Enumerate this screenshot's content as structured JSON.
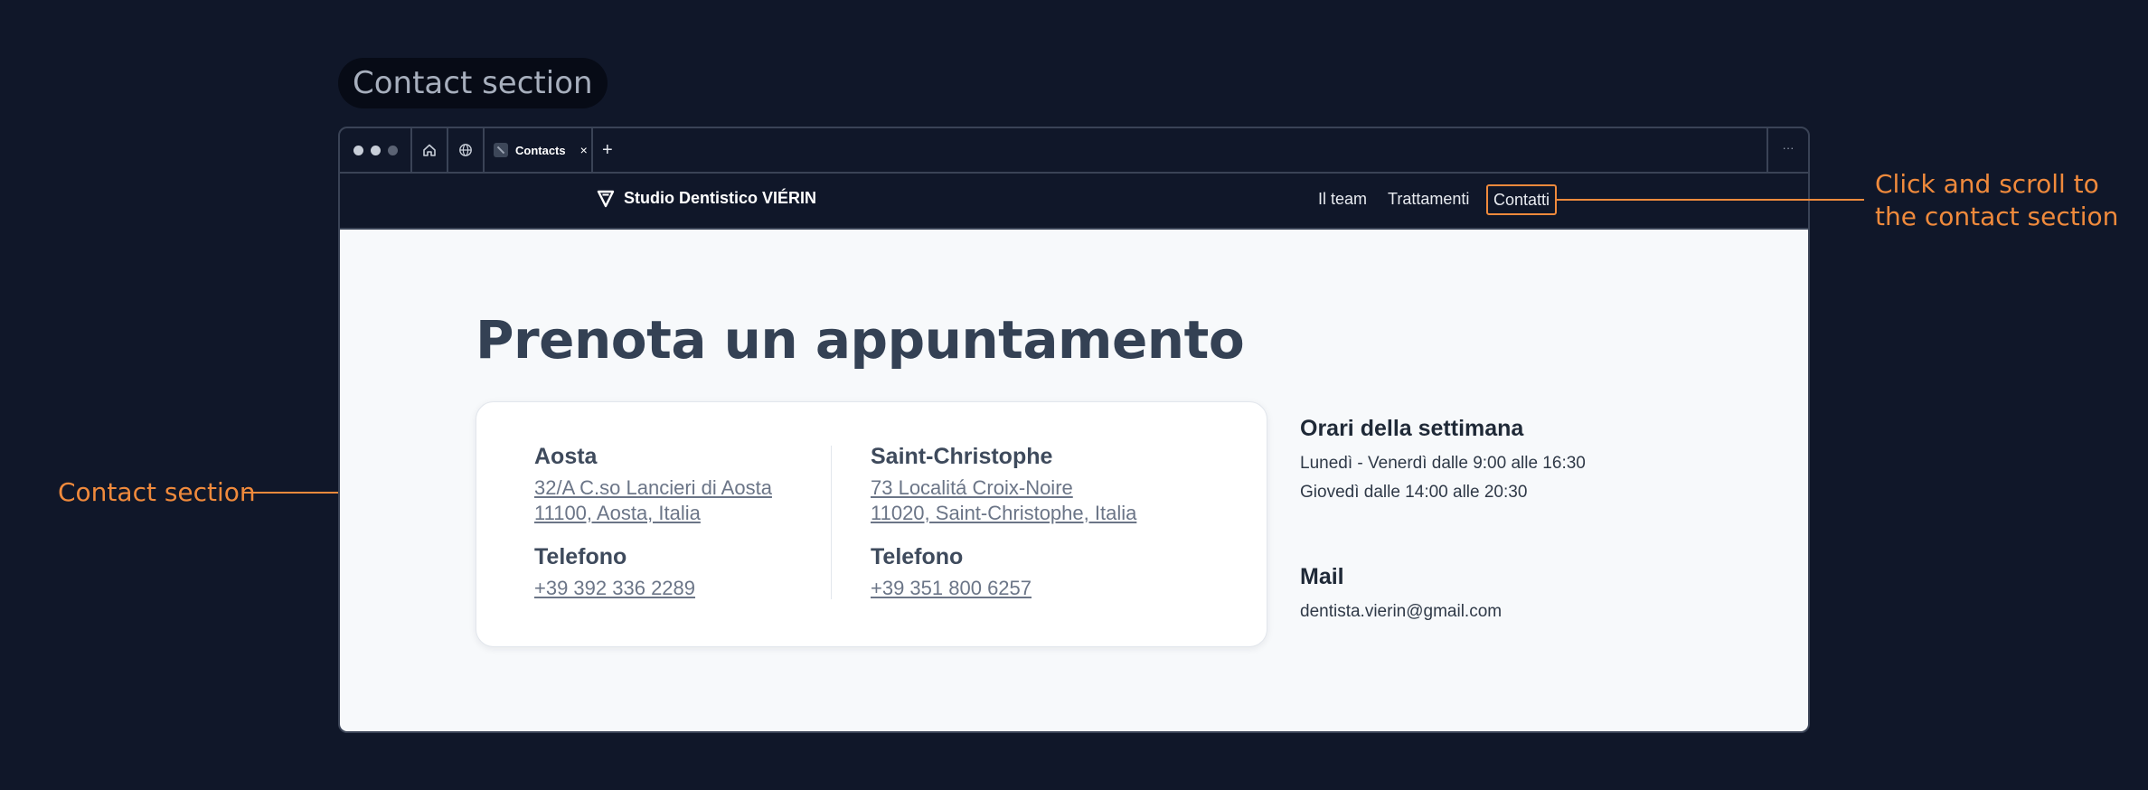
{
  "section_label": "Contact section",
  "browser": {
    "tab_title": "Contacts",
    "tab_close": "×",
    "new_tab": "+",
    "more": "···"
  },
  "site": {
    "brand": "Studio Dentistico VIÉRIN",
    "nav": {
      "team": "Il team",
      "treatments": "Trattamenti",
      "contacts": "Contatti"
    }
  },
  "page": {
    "headline": "Prenota un appuntamento",
    "locations": [
      {
        "city": "Aosta",
        "address_line1": "32/A  C.so Lancieri di Aosta",
        "address_line2": "11100, Aosta, Italia",
        "phone_label": "Telefono",
        "phone": "+39 392 336 2289"
      },
      {
        "city": "Saint-Christophe",
        "address_line1": "73  Localitá Croix-Noire",
        "address_line2": "11020, Saint-Christophe, Italia",
        "phone_label": "Telefono",
        "phone": "+39 351 800 6257"
      }
    ],
    "hours": {
      "title": "Orari della settimana",
      "line1": "Lunedì - Venerdì dalle 9:00 alle 16:30",
      "line2": "Giovedì dalle 14:00 alle 20:30"
    },
    "mail": {
      "title": "Mail",
      "address": "dentista.vierin@gmail.com"
    }
  },
  "annotations": {
    "right_line1": "Click and scroll to",
    "right_line2": "the contact section",
    "left": "Contact section"
  },
  "colors": {
    "accent": "#f08a3c",
    "background": "#101729",
    "content_bg": "#f7f9fb"
  }
}
